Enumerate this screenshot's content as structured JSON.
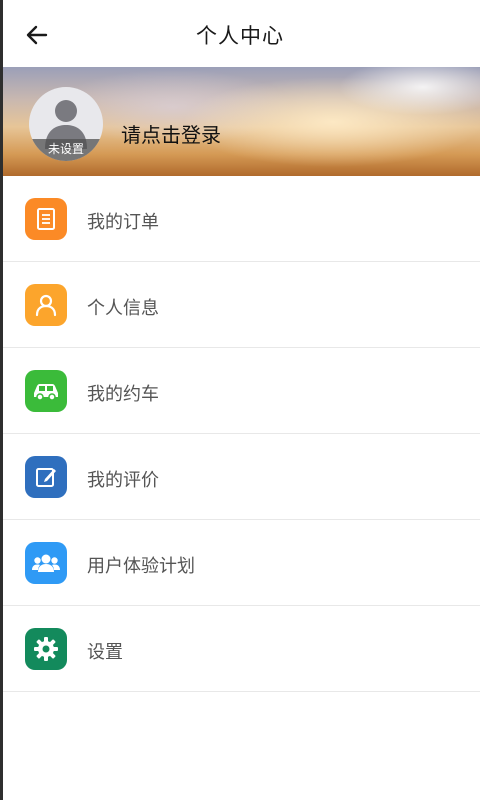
{
  "header": {
    "title": "个人中心",
    "back_icon": "arrow-left-icon"
  },
  "profile": {
    "avatar_badge": "未设置",
    "login_prompt": "请点击登录"
  },
  "menu": [
    {
      "label": "我的订单",
      "icon": "order-document-icon",
      "color": "#fb8a26"
    },
    {
      "label": "个人信息",
      "icon": "person-icon",
      "color": "#fca52c"
    },
    {
      "label": "我的约车",
      "icon": "car-icon",
      "color": "#3bbb3a"
    },
    {
      "label": "我的评价",
      "icon": "edit-review-icon",
      "color": "#2f6fbe"
    },
    {
      "label": "用户体验计划",
      "icon": "user-group-icon",
      "color": "#2f9af5"
    },
    {
      "label": "设置",
      "icon": "gear-icon",
      "color": "#138a5c"
    }
  ]
}
